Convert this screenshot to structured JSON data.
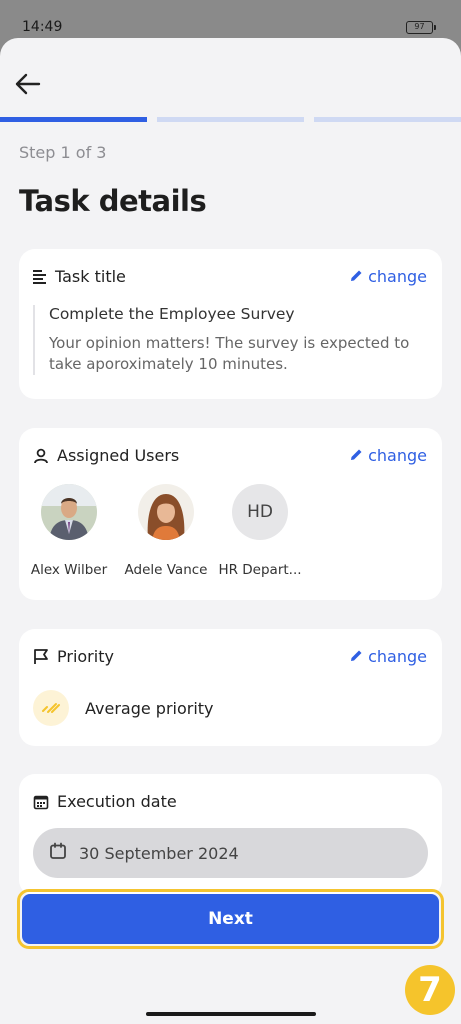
{
  "status": {
    "time": "14:49",
    "battery": "97"
  },
  "progress": {
    "current": 1,
    "total": 3
  },
  "step_label": "Step 1 of 3",
  "page_title": "Task details",
  "task_card": {
    "heading": "Task title",
    "change_label": "change",
    "name": "Complete the Employee Survey",
    "description": "Your opinion matters! The survey is expected to take aporoximately 10 minutes."
  },
  "users_card": {
    "heading": "Assigned Users",
    "change_label": "change",
    "users": [
      {
        "name": "Alex Wilber"
      },
      {
        "name": "Adele Vance"
      },
      {
        "name": "HR Depart...",
        "initials": "HD"
      }
    ]
  },
  "priority_card": {
    "heading": "Priority",
    "change_label": "change",
    "value": "Average priority"
  },
  "date_card": {
    "heading": "Execution date",
    "value": "30 September 2024"
  },
  "next_button": "Next",
  "step_badge": "7",
  "colors": {
    "accent": "#2f5fe3",
    "highlight": "#f4c430",
    "priority": "#f5c42c"
  }
}
